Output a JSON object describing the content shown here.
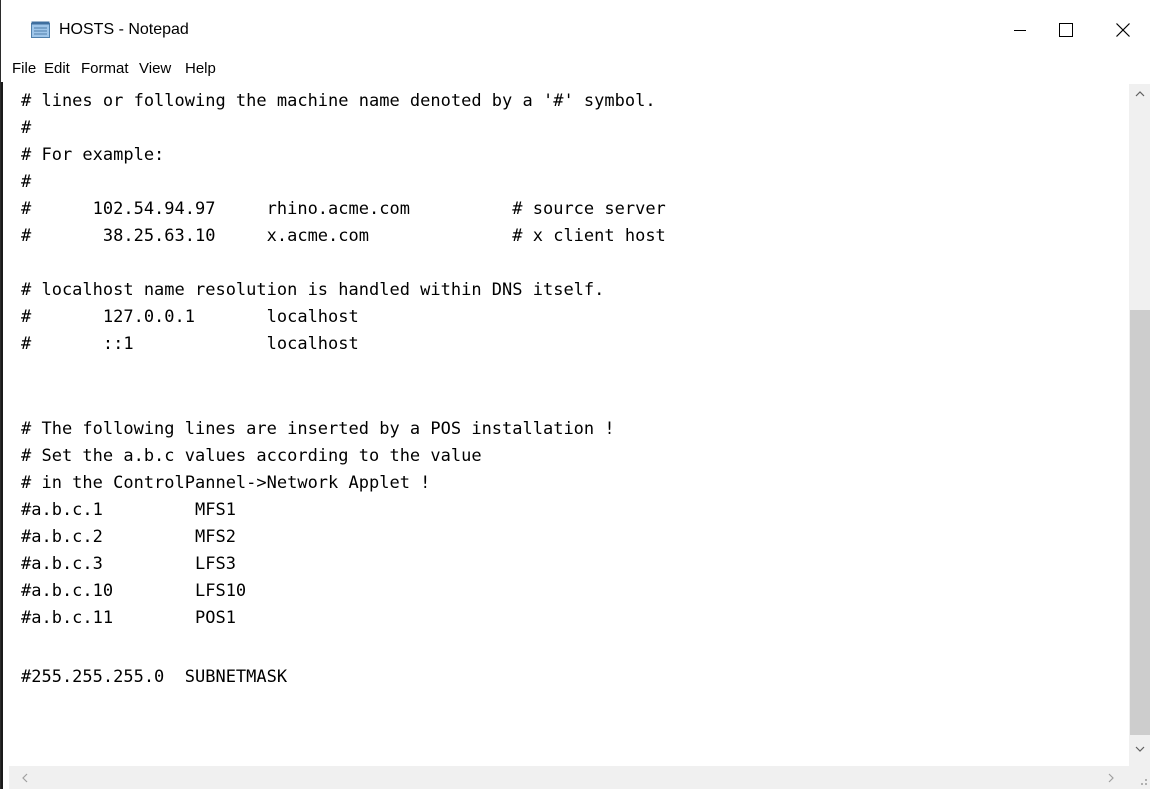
{
  "window": {
    "title": "HOSTS - Notepad",
    "icon": "notepad-icon",
    "controls": {
      "minimize_icon": "minimize-icon",
      "maximize_icon": "maximize-icon",
      "close_icon": "close-icon"
    }
  },
  "menu": {
    "items": [
      "File",
      "Edit",
      "Format",
      "View",
      "Help"
    ]
  },
  "document": {
    "lines": [
      "# lines or following the machine name denoted by a '#' symbol.",
      "#",
      "# For example:",
      "#",
      "#      102.54.94.97     rhino.acme.com          # source server",
      "#       38.25.63.10     x.acme.com              # x client host",
      "",
      "# localhost name resolution is handled within DNS itself.",
      "#       127.0.0.1       localhost",
      "#       ::1             localhost",
      "",
      "",
      "# The following lines are inserted by a POS installation !",
      "# Set the a.b.c values according to the value",
      "# in the ControlPannel->Network Applet !",
      "#a.b.c.1         MFS1",
      "#a.b.c.2         MFS2",
      "#a.b.c.3         LFS3",
      "#a.b.c.10        LFS10",
      "#a.b.c.11        POS1",
      "",
      "#255.255.255.0  SUBNETMASK"
    ]
  },
  "scrollbars": {
    "vertical": {
      "up_icon": "scroll-up-icon",
      "down_icon": "scroll-down-icon",
      "position_fraction": 0.35
    },
    "horizontal": {
      "left_icon": "scroll-left-icon",
      "right_icon": "scroll-right-icon"
    }
  }
}
